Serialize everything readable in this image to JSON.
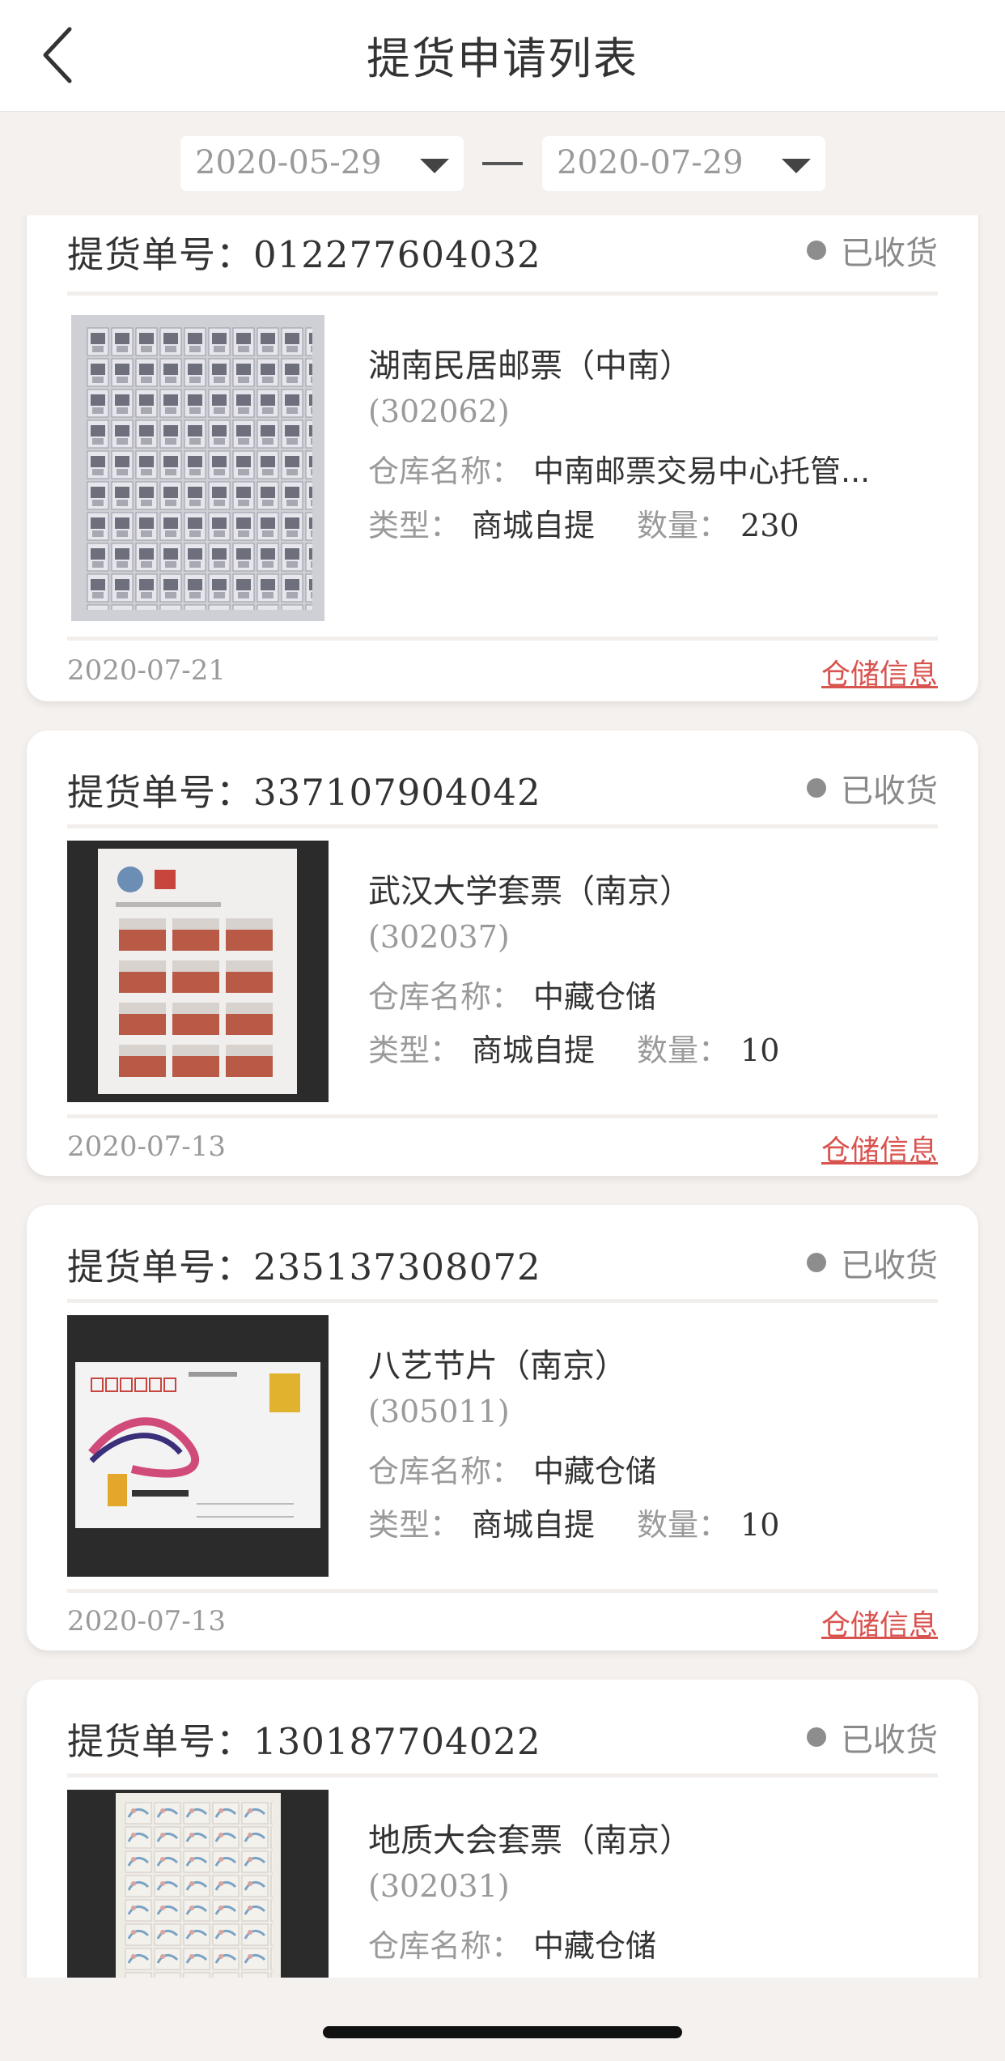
{
  "header": {
    "title": "提货申请列表"
  },
  "filter": {
    "start_date": "2020-05-29",
    "end_date": "2020-07-29"
  },
  "labels": {
    "order_prefix": "提货单号：",
    "warehouse": "仓库名称：",
    "type": "类型：",
    "quantity": "数量：",
    "link": "仓储信息"
  },
  "orders": [
    {
      "order_no": "012277604032",
      "status": "已收货",
      "name": "湖南民居邮票（中南）",
      "code": "(302062)",
      "warehouse": "中南邮票交易中心托管...",
      "type": "商城自提",
      "quantity": "230",
      "date": "2020-07-21"
    },
    {
      "order_no": "337107904042",
      "status": "已收货",
      "name": "武汉大学套票（南京）",
      "code": "(302037)",
      "warehouse": "中藏仓储",
      "type": "商城自提",
      "quantity": "10",
      "date": "2020-07-13"
    },
    {
      "order_no": "235137308072",
      "status": "已收货",
      "name": "八艺节片（南京）",
      "code": "(305011)",
      "warehouse": "中藏仓储",
      "type": "商城自提",
      "quantity": "10",
      "date": "2020-07-13"
    },
    {
      "order_no": "130187704022",
      "status": "已收货",
      "name": "地质大会套票（南京）",
      "code": "(302031)",
      "warehouse": "中藏仓储"
    }
  ],
  "icons": {
    "back": "chevron-left-icon",
    "dropdown": "caret-down-icon",
    "status": "status-dot-icon"
  },
  "colors": {
    "link": "#d9534f",
    "status_dot": "#8d8d8d",
    "background": "#f5f1ef"
  }
}
